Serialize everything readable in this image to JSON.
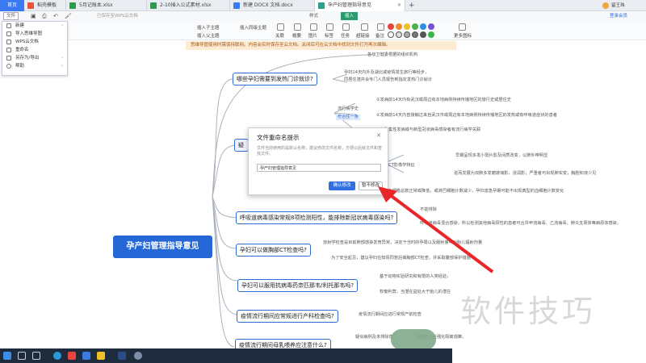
{
  "tabs": {
    "home": "首页",
    "items": [
      {
        "label": "稻壳模板",
        "color": "#e9523b"
      },
      {
        "label": "5月记账本.xlsx",
        "color": "#2b9a4f"
      },
      {
        "label": "2-10插入公式素材.xlsx",
        "color": "#2b9a4f"
      },
      {
        "label": "新建 DOCX 文档.docx",
        "color": "#3a79f2"
      },
      {
        "label": "孕产妇管理指导意见",
        "color": "#28a28a"
      }
    ],
    "login": "登录会员",
    "user": "留王玮"
  },
  "toolbar": {
    "file": "文件",
    "saved_status": "已保存至WPS云文档",
    "style": "样式",
    "insert": "插入",
    "export": "导出"
  },
  "file_menu": [
    {
      "label": "新建",
      "icon": "new-icon",
      "has_sub": true
    },
    {
      "label": "导入思维导图",
      "icon": "import-icon",
      "has_sub": false
    },
    {
      "label": "WPS云文档",
      "icon": "cloud-icon",
      "has_sub": false
    },
    {
      "label": "重命名",
      "icon": "rename-icon",
      "has_sub": false
    },
    {
      "label": "另存为/导出",
      "icon": "saveas-icon",
      "has_sub": true
    },
    {
      "label": "帮助",
      "icon": "help-icon",
      "has_sub": true
    }
  ],
  "ribbon": {
    "insert_child": "插入子主题",
    "insert_parent": "插入父主题",
    "insert_sibling": "插入同级主题",
    "relation": "关联",
    "summary": "概要",
    "image": "图片",
    "label": "标签",
    "task": "任务",
    "hyperlink": "超链接",
    "note": "备注",
    "more_icons": "更多图标"
  },
  "banner": "思维导图使用时需保持联网。内容会实时保存至云文档。关闭后可在云文档中找到文件打开再次编辑。",
  "mindmap": {
    "root": "孕产妇管理指导意见",
    "top_partial": "各级卫健委根据的组织机构",
    "nodes": [
      "哪些孕妇需要到发热门诊就诊?",
      "疑",
      "呼吸道病毒感染常规8项检测阳性，能排除新冠状病毒感染吗?",
      "孕妇可以做胸部CT检查吗?",
      "孕妇可以服用抗病毒药奈匹那韦/利托那韦吗?",
      "疫情流行期间应常规进行产科检查吗?",
      "疫情流行期间母乳喂养应注意什么?"
    ],
    "sub_texts": [
      "孕妇14天内外及湖北或疫情发生旅行等经步，",
      "同居住潜并会专门人员报告到指定发热门诊就诊",
      "流行病学史",
      "符合任一条",
      "①发病前14天内有武汉或周边有本地病例持续传播地区的旅行史或居住史",
      "②发病前14天内曾接触过来自武汉市或周边有本地病例持续传播地区的发热或有呼吸道症状的患者",
      "③有聚集性发病或与新型冠状病毒感染者有流行病学关联",
      "早期呈现多发小斑片影及间质改变，以肺外带明显",
      "进而发展为双肺多发磨玻璃影、浸润影，严重者可出现肺实变，胸腔积液少见",
      "CT影像学特征",
      "早期白细胞总数正常或降低，或淋巴细胞计数减少，孕妇患急孕期可能不出现典型的血细胞计数变化",
      "不能排除",
      "呼吸道病毒混合感染，所以检测其他病毒阳性的患者可合并甲流病毒、乙流病毒、肺炎支原体等病原体感染。",
      "放射学检查是目前肺部感染发育异常，决定于当时的孕周以及服射量中对胎儿辐射剂量",
      "为了安全起见，建议孕妇在知情同意后做胸部CT检查，并采取腹部保护措施",
      "基于动物实验研究和有限的人类经验，",
      "权衡利弊，当潜在益处大于胎儿的潜在",
      "疫情流行期间应进行常规产前检查",
      "疑似病例及未排除感",
      "的新生儿应强化隔离观察。"
    ]
  },
  "dialog": {
    "title": "文件重命名提示",
    "description": "文件当前使用的是默认名称，建议修改文件名称，方便以后就文件和查找文件。",
    "input_value": "孕产妇管理指导意见",
    "ok": "确认修改",
    "cancel": "暂不修改"
  },
  "watermark": "软件技巧",
  "colors": {
    "accent": "#2f6fe0",
    "root": "#2567d6",
    "node_border": "#2d6cd1",
    "arrow": "#e8262a",
    "banner_bg": "#fdebd3"
  }
}
